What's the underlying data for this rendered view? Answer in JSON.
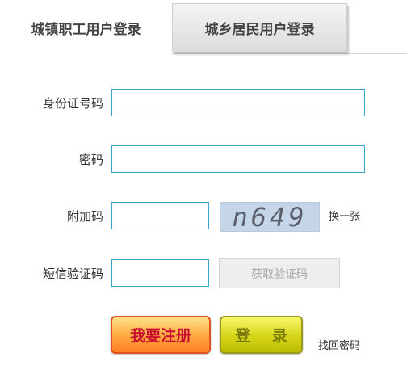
{
  "tabs": {
    "urban_employee": "城镇职工用户登录",
    "urban_rural_resident": "城乡居民用户登录"
  },
  "form": {
    "id_label": "身份证号码",
    "id_value": "",
    "password_label": "密码",
    "password_value": "",
    "extra_code_label": "附加码",
    "extra_code_value": "",
    "captcha_text": "n649",
    "captcha_refresh": "换一张",
    "sms_label": "短信验证码",
    "sms_value": "",
    "sms_button": "获取验证码"
  },
  "actions": {
    "register": "我要注册",
    "login": "登 录",
    "forgot_password": "找回密码"
  }
}
